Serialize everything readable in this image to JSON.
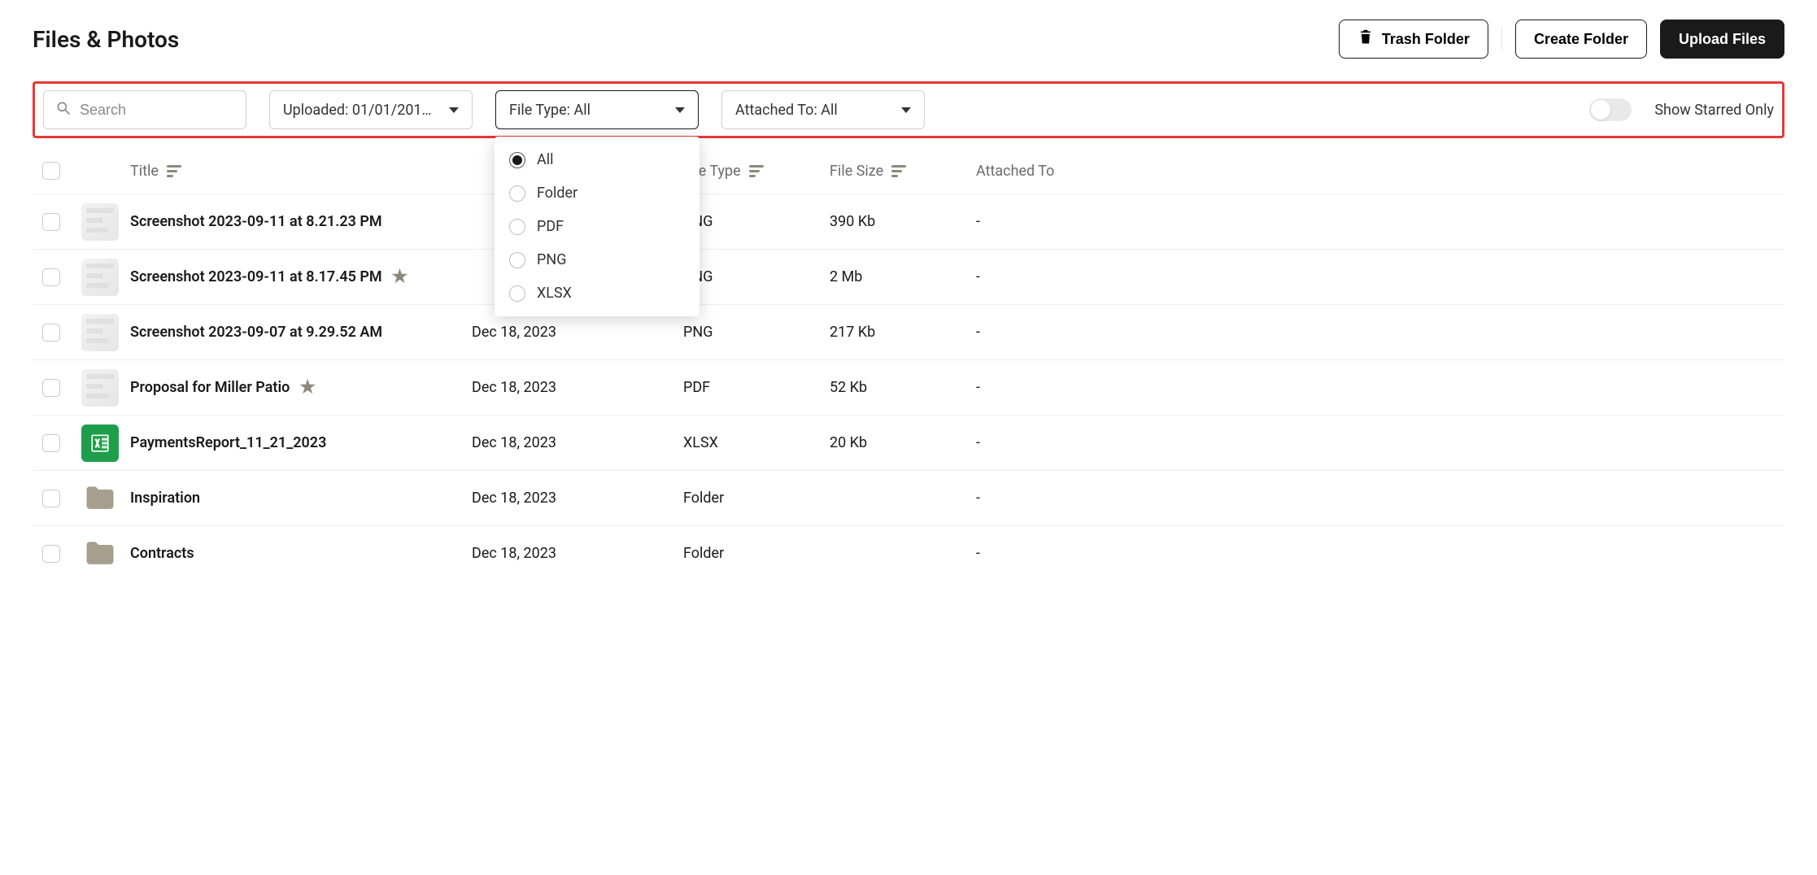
{
  "header": {
    "title": "Files & Photos",
    "trash": "Trash Folder",
    "create": "Create Folder",
    "upload": "Upload Files"
  },
  "filters": {
    "search_placeholder": "Search",
    "uploaded_label": "Uploaded: 01/01/201…",
    "file_type_label": "File Type: All",
    "attached_to_label": "Attached To: All",
    "starred_label": "Show Starred Only",
    "file_type_options": [
      {
        "label": "All",
        "selected": true
      },
      {
        "label": "Folder",
        "selected": false
      },
      {
        "label": "PDF",
        "selected": false
      },
      {
        "label": "PNG",
        "selected": false
      },
      {
        "label": "XLSX",
        "selected": false
      }
    ]
  },
  "columns": {
    "title": "Title",
    "file_type": "File Type",
    "file_size": "File Size",
    "attached_to": "Attached To"
  },
  "rows": [
    {
      "title": "Screenshot 2023-09-11 at 8.21.23 PM",
      "starred": false,
      "date": "",
      "type": "PNG",
      "size": "390 Kb",
      "attached": "-",
      "thumb": "img"
    },
    {
      "title": "Screenshot 2023-09-11 at 8.17.45 PM",
      "starred": true,
      "date": "",
      "type": "PNG",
      "size": "2 Mb",
      "attached": "-",
      "thumb": "img"
    },
    {
      "title": "Screenshot 2023-09-07 at 9.29.52 AM",
      "starred": false,
      "date": "Dec 18, 2023",
      "type": "PNG",
      "size": "217 Kb",
      "attached": "-",
      "thumb": "img"
    },
    {
      "title": "Proposal for Miller Patio",
      "starred": true,
      "date": "Dec 18, 2023",
      "type": "PDF",
      "size": "52 Kb",
      "attached": "-",
      "thumb": "img"
    },
    {
      "title": "PaymentsReport_11_21_2023",
      "starred": false,
      "date": "Dec 18, 2023",
      "type": "XLSX",
      "size": "20 Kb",
      "attached": "-",
      "thumb": "xlsx"
    },
    {
      "title": "Inspiration",
      "starred": false,
      "date": "Dec 18, 2023",
      "type": "Folder",
      "size": "",
      "attached": "-",
      "thumb": "folder"
    },
    {
      "title": "Contracts",
      "starred": false,
      "date": "Dec 18, 2023",
      "type": "Folder",
      "size": "",
      "attached": "-",
      "thumb": "folder"
    }
  ]
}
